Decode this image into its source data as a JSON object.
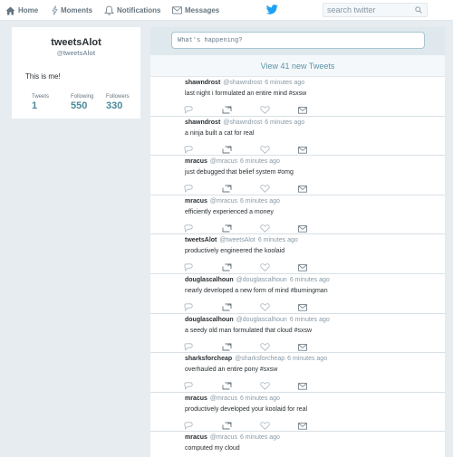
{
  "nav": {
    "home": "Home",
    "moments": "Moments",
    "notifications": "Notifications",
    "messages": "Messages"
  },
  "search": {
    "placeholder": "search twitter"
  },
  "profile": {
    "name": "tweetsAlot",
    "handle": "@tweetsAlot",
    "bio": "This is me!",
    "stats": {
      "tweets_label": "Tweets",
      "tweets_value": "1",
      "following_label": "Following",
      "following_value": "550",
      "followers_label": "Followers",
      "followers_value": "330"
    }
  },
  "compose": {
    "placeholder": "What's happening?"
  },
  "new_tweets": "View 41 new Tweets",
  "tweets": [
    {
      "name": "shawndrost",
      "handle": "@shawndrost",
      "time": "6 minutes ago",
      "text": "last night i formulated an entire mind #sxsw"
    },
    {
      "name": "shawndrost",
      "handle": "@shawndrost",
      "time": "6 minutes ago",
      "text": "a ninja built a cat for real"
    },
    {
      "name": "mracus",
      "handle": "@mracus",
      "time": "6 minutes ago",
      "text": "just debugged that belief system #omg"
    },
    {
      "name": "mracus",
      "handle": "@mracus",
      "time": "6 minutes ago",
      "text": "efficiently experienced a money"
    },
    {
      "name": "tweetsAlot",
      "handle": "@tweetsAlot",
      "time": "6 minutes ago",
      "text": "productively engineered the koolaid"
    },
    {
      "name": "douglascalhoun",
      "handle": "@douglascalhoun",
      "time": "6 minutes ago",
      "text": "nearly developed a new form of mind #burningman"
    },
    {
      "name": "douglascalhoun",
      "handle": "@douglascalhoun",
      "time": "6 minutes ago",
      "text": "a seedy old man formulated that cloud #sxsw"
    },
    {
      "name": "sharksforcheap",
      "handle": "@sharksforcheap",
      "time": "6 minutes ago",
      "text": "overhauled an entire pony #sxsw"
    },
    {
      "name": "mracus",
      "handle": "@mracus",
      "time": "6 minutes ago",
      "text": "productively developed your koolaid for real"
    },
    {
      "name": "mracus",
      "handle": "@mracus",
      "time": "6 minutes ago",
      "text": "computed my cloud"
    }
  ],
  "icons": {
    "home": "home-icon",
    "moments": "lightning-icon",
    "notifications": "bell-icon",
    "messages": "envelope-icon",
    "brand": "twitter-bird-icon",
    "search": "search-icon",
    "reply": "reply-icon",
    "retweet": "retweet-icon",
    "like": "heart-icon",
    "dm": "direct-message-icon"
  },
  "colors": {
    "accent": "#1da1f2",
    "background": "#e6ecf0",
    "stat_value": "#4a8a9a",
    "link": "#5c93a8"
  }
}
